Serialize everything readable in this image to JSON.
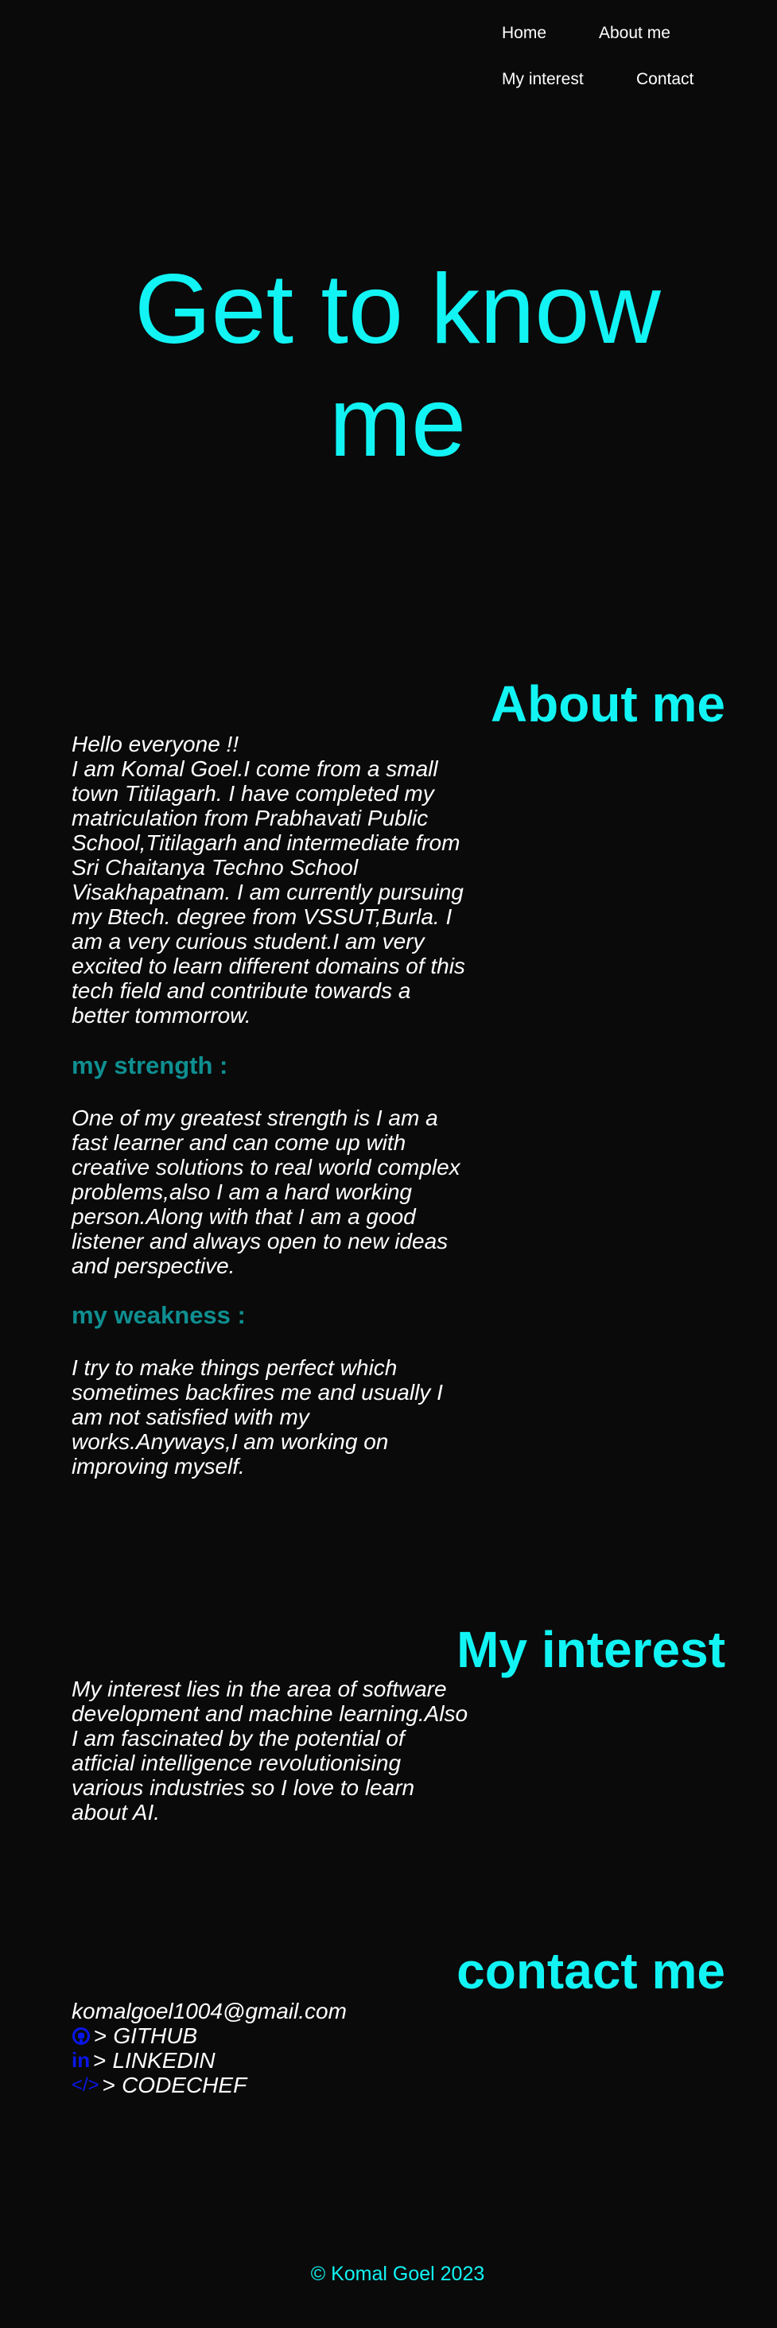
{
  "nav": {
    "home": "Home",
    "about": "About me",
    "interest": "My interest",
    "contact": "Contact"
  },
  "hero": {
    "line1": "Get to know",
    "line2": "me"
  },
  "about": {
    "title": "About me",
    "greeting": "Hello everyone !!",
    "body": "I am Komal Goel.I come from a small town Titilagarh. I have completed my matriculation from Prabhavati Public School,Titilagarh and intermediate from Sri Chaitanya Techno School Visakhapatnam. I am currently pursuing my Btech. degree from VSSUT,Burla. I am a very curious student.I am very excited to learn different domains of this tech field and contribute towards a better tommorrow.",
    "strength_heading": "my strength :",
    "strength_body": "One of my greatest strength is I am a fast learner and can come up with creative solutions to real world complex problems,also I am a hard working person.Along with that I am a good listener and always open to new ideas and perspective.",
    "weakness_heading": "my weakness :",
    "weakness_body": "I try to make things perfect which sometimes backfires me and usually I am not satisfied with my works.Anyways,I am working on improving myself."
  },
  "interest": {
    "title": "My interest",
    "body": "My interest lies in the area of software development and machine learning.Also I am fascinated by the potential of atficial intelligence revolutionising various industries so I love to learn about AI."
  },
  "contact": {
    "title": "contact me",
    "email": "komalgoel1004@gmail.com",
    "arrow": ">",
    "github": "GITHUB",
    "linkedin": "LINKEDIN",
    "codechef": "CODECHEF",
    "linkedin_icon": "in",
    "codechef_icon": "</>",
    "icon_color": "#0a16e8"
  },
  "footer": {
    "text": "© Komal Goel 2023"
  },
  "colors": {
    "background": "#0a0a0a",
    "accent": "#12f4f4",
    "subheading": "#0f8f91"
  }
}
